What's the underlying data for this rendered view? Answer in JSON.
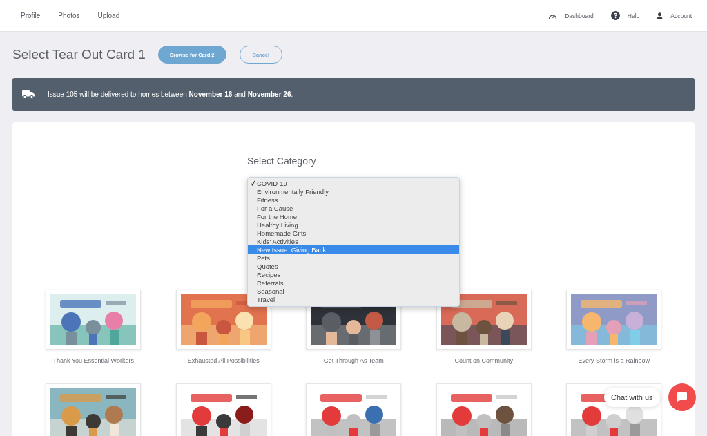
{
  "nav": {
    "left": [
      {
        "label": "Profile"
      },
      {
        "label": "Photos"
      },
      {
        "label": "Upload"
      }
    ],
    "right": [
      {
        "kind": "dashboard",
        "label": "Dashboard"
      },
      {
        "kind": "help",
        "label": "Help"
      },
      {
        "kind": "account",
        "label": "Account"
      }
    ]
  },
  "page_title": "Select Tear Out Card 1",
  "buttons": [
    {
      "kind": "primary",
      "label": "Browse for Card 2"
    },
    {
      "kind": "outline",
      "label": "Cancel"
    }
  ],
  "banner": {
    "text": "Issue 105 will be delivered to homes between **November 16** and **November 26**."
  },
  "category": {
    "heading": "Select Category",
    "options": [
      {
        "label": "COVID-19",
        "checked": true,
        "selected": false
      },
      {
        "label": "Environmentally Friendly",
        "checked": false,
        "selected": false
      },
      {
        "label": "Fitness",
        "checked": false,
        "selected": false
      },
      {
        "label": "For a Cause",
        "checked": false,
        "selected": false
      },
      {
        "label": "For the Home",
        "checked": false,
        "selected": false
      },
      {
        "label": "Healthy Living",
        "checked": false,
        "selected": false
      },
      {
        "label": "Homemade Gifts",
        "checked": false,
        "selected": false
      },
      {
        "label": "Kids' Activities",
        "checked": false,
        "selected": false
      },
      {
        "label": "New Issue: Giving Back",
        "checked": false,
        "selected": true
      },
      {
        "label": "Pets",
        "checked": false,
        "selected": false
      },
      {
        "label": "Quotes",
        "checked": false,
        "selected": false
      },
      {
        "label": "Recipes",
        "checked": false,
        "selected": false
      },
      {
        "label": "Referrals",
        "checked": false,
        "selected": false
      },
      {
        "label": "Seasonal",
        "checked": false,
        "selected": false
      },
      {
        "label": "Travel",
        "checked": false,
        "selected": false
      }
    ]
  },
  "cards": [
    {
      "title": "Thank You Essential Workers"
    },
    {
      "title": "Exhausted All Possibilities"
    },
    {
      "title": "Get Through As Team"
    },
    {
      "title": "Count on Community"
    },
    {
      "title": "Every Storm is a Rainbow"
    },
    {
      "kind": "picture"
    },
    {
      "kind": "picture"
    },
    {
      "kind": "picture"
    },
    {
      "kind": "picture"
    },
    {
      "kind": "picture"
    }
  ],
  "chat": {
    "label": "Chat with us"
  }
}
